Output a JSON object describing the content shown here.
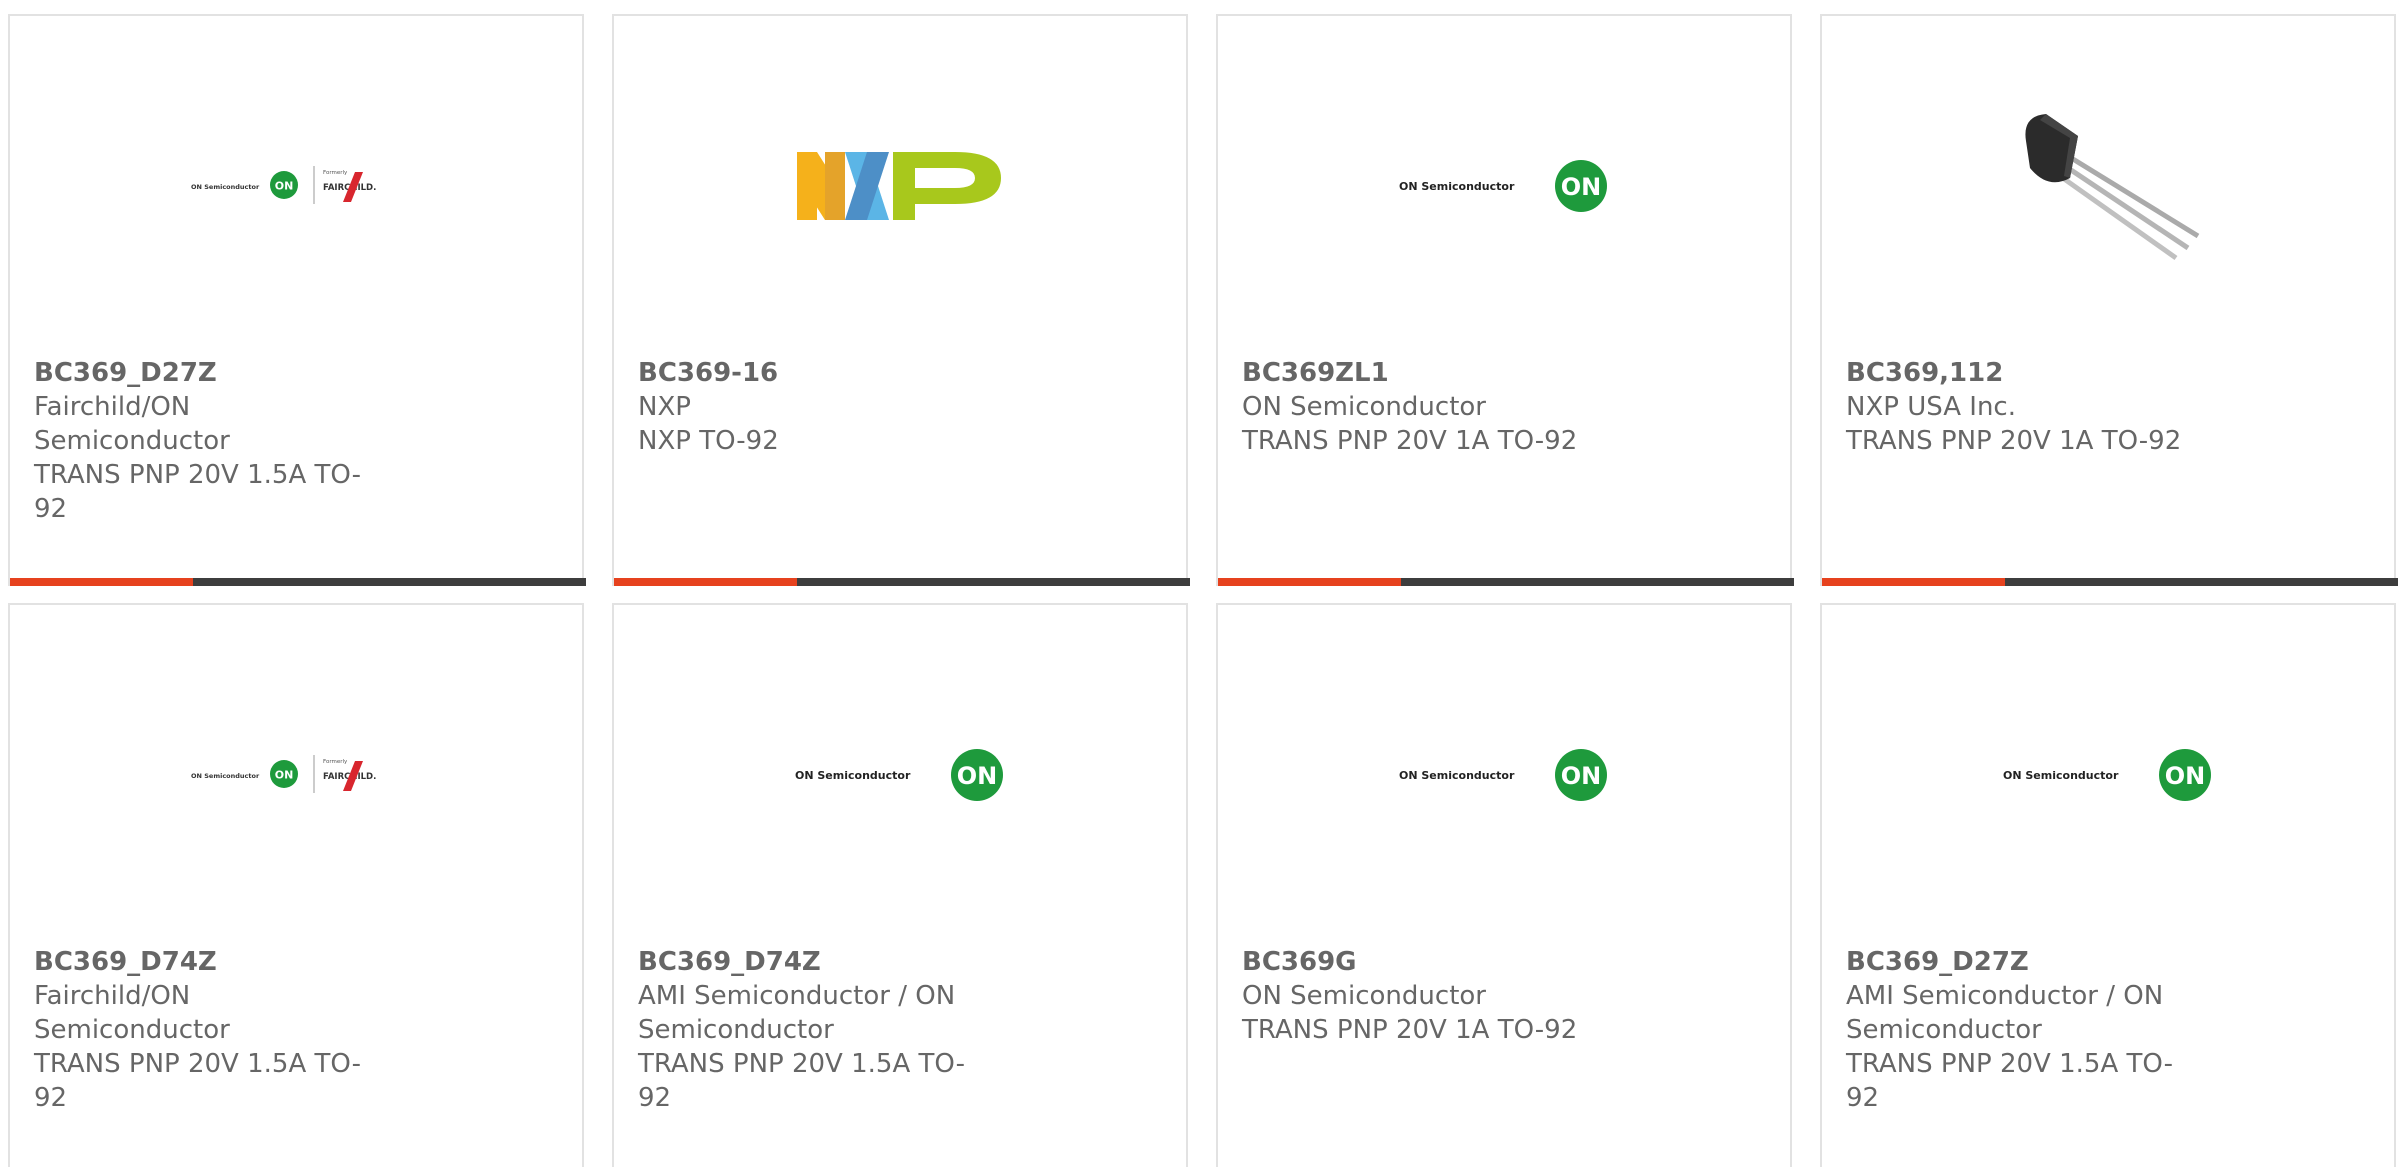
{
  "accent_color": "#e6421e",
  "bar_color": "#3d3d3d",
  "text_color": "#666666",
  "cards": [
    {
      "part": "BC369_D27Z",
      "manufacturer": "Fairchild/ON Semiconductor",
      "description": "TRANS PNP 20V 1.5A TO-92",
      "logo": "on-fairchild-logo"
    },
    {
      "part": "BC369-16",
      "manufacturer": "NXP",
      "description": "NXP TO-92",
      "logo": "nxp-logo"
    },
    {
      "part": "BC369ZL1",
      "manufacturer": "ON Semiconductor",
      "description": "TRANS PNP 20V 1A TO-92",
      "logo": "on-semiconductor-logo"
    },
    {
      "part": "BC369,112",
      "manufacturer": "NXP USA Inc.",
      "description": "TRANS PNP 20V 1A TO-92",
      "logo": "to92-transistor-image"
    },
    {
      "part": "BC369_D74Z",
      "manufacturer": "Fairchild/ON Semiconductor",
      "description": "TRANS PNP 20V 1.5A TO-92",
      "logo": "on-fairchild-logo"
    },
    {
      "part": "BC369_D74Z",
      "manufacturer": "AMI Semiconductor / ON Semiconductor",
      "description": "TRANS PNP 20V 1.5A TO-92",
      "logo": "on-semiconductor-logo"
    },
    {
      "part": "BC369G",
      "manufacturer": "ON Semiconductor",
      "description": "TRANS PNP 20V 1A TO-92",
      "logo": "on-semiconductor-logo"
    },
    {
      "part": "BC369_D27Z",
      "manufacturer": "AMI Semiconductor / ON Semiconductor",
      "description": "TRANS PNP 20V 1.5A TO-92",
      "logo": "on-semiconductor-logo"
    }
  ],
  "logo_text": {
    "on_semi": "ON Semiconductor",
    "on_mark": "ON",
    "formerly": "Formerly",
    "fairchild": "FAIRCHILD."
  }
}
